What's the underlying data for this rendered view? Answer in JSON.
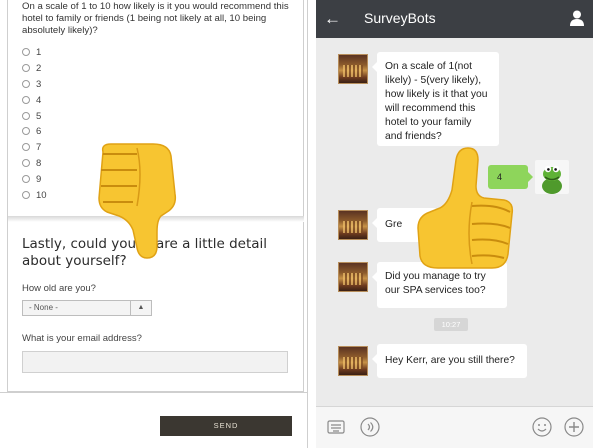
{
  "left": {
    "question1": "On a scale of 1 to 10 how likely is it you would recommend this hotel to family or friends (1 being not likely at all, 10 being absolutely likely)?",
    "options": [
      "1",
      "2",
      "3",
      "4",
      "5",
      "6",
      "7",
      "8",
      "9",
      "10"
    ],
    "section_heading": "Lastly, could you share a little detail about yourself?",
    "age_label": "How old are you?",
    "age_select_value": "- None -",
    "email_label": "What is your email address?",
    "send_label": "SEND"
  },
  "right": {
    "app_title": "SurveyBots",
    "bot_msg_1": "On a scale of 1(not likely) - 5(very likely), how likely is it that you will recommend this hotel to your family and friends?",
    "user_reply": "4",
    "bot_msg_2": "Gre",
    "bot_msg_3": "Did you manage to try our SPA services too?",
    "timestamp": "10:27",
    "bot_msg_4": "Hey Kerr, are you still there?"
  },
  "icons": {
    "thumbs_down": "thumbs-down-emoji",
    "thumbs_up": "thumbs-up-emoji",
    "back": "arrow-left-icon",
    "user": "person-icon",
    "keyboard": "keyboard-icon",
    "voice": "voice-icon",
    "emoji": "smiley-icon",
    "add": "plus-circle-icon"
  },
  "colors": {
    "appbar": "#3c3f44",
    "send_button": "#3b3731",
    "user_bubble": "#8ed55b",
    "thumb_yellow": "#f7c531"
  }
}
